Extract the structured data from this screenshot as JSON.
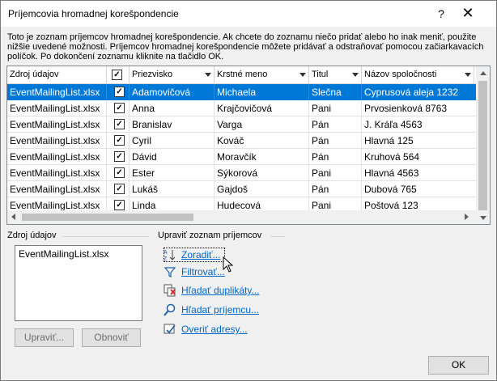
{
  "window": {
    "title": "Príjemcovia hromadnej korešpondencie",
    "help_glyph": "?",
    "close_glyph": "✕"
  },
  "instructions": "Toto je zoznam príjemcov hromadnej korešpondencie. Ak chcete do zoznamu niečo pridať alebo ho inak meniť, použite nižšie uvedené možnosti. Príjemcov hromadnej korešpondencie môžete pridávať a odstraňovať pomocou začiarkavacích políčok. Po dokončení zoznamu kliknite na tlačidlo OK.",
  "grid": {
    "columns": [
      "Zdroj údajov",
      "",
      "Priezvisko",
      "Krstné meno",
      "Titul",
      "Názov spoločnosti"
    ],
    "header_checked": true,
    "rows": [
      {
        "source": "EventMailingList.xlsx",
        "checked": true,
        "surname": "Adamovičová",
        "first": "Michaela",
        "title": "Slečna",
        "company": "Cyprusová aleja 1232",
        "selected": true
      },
      {
        "source": "EventMailingList.xlsx",
        "checked": true,
        "surname": "Anna",
        "first": "Krajčovičová",
        "title": "Pani",
        "company": "Prvosienková 8763",
        "selected": false
      },
      {
        "source": "EventMailingList.xlsx",
        "checked": true,
        "surname": "Branislav",
        "first": "Varga",
        "title": "Pán",
        "company": "J. Kráľa 4563",
        "selected": false
      },
      {
        "source": "EventMailingList.xlsx",
        "checked": true,
        "surname": "Cyril",
        "first": "Kováč",
        "title": "Pán",
        "company": "Hlavná 125",
        "selected": false
      },
      {
        "source": "EventMailingList.xlsx",
        "checked": true,
        "surname": "Dávid",
        "first": "Moravčík",
        "title": "Pán",
        "company": "Kruhová 564",
        "selected": false
      },
      {
        "source": "EventMailingList.xlsx",
        "checked": true,
        "surname": "Ester",
        "first": "Sýkorová",
        "title": "Pani",
        "company": "Hlavná 4563",
        "selected": false
      },
      {
        "source": "EventMailingList.xlsx",
        "checked": true,
        "surname": "Lukáš",
        "first": "Gajdoš",
        "title": "Pán",
        "company": "Dubová 765",
        "selected": false
      },
      {
        "source": "EventMailingList.xlsx",
        "checked": true,
        "surname": "Linda",
        "first": "Hudecová",
        "title": "Pani",
        "company": "Poštová 123",
        "selected": false
      }
    ]
  },
  "data_source": {
    "label": "Zdroj údajov",
    "items": [
      "EventMailingList.xlsx"
    ],
    "edit_button": "Upraviť...",
    "refresh_button": "Obnoviť"
  },
  "refine": {
    "label": "Upraviť zoznam príjemcov",
    "links": [
      {
        "label": "Zoradiť...",
        "icon": "sort-az-icon"
      },
      {
        "label": "Filtrovať...",
        "icon": "filter-icon"
      },
      {
        "label": "Hľadať duplikáty...",
        "icon": "find-duplicates-icon"
      },
      {
        "label": "Hľadať príjemcu...",
        "icon": "find-recipient-icon"
      },
      {
        "label": "Overiť adresy...",
        "icon": "validate-addresses-icon"
      }
    ]
  },
  "ok_button": "OK"
}
